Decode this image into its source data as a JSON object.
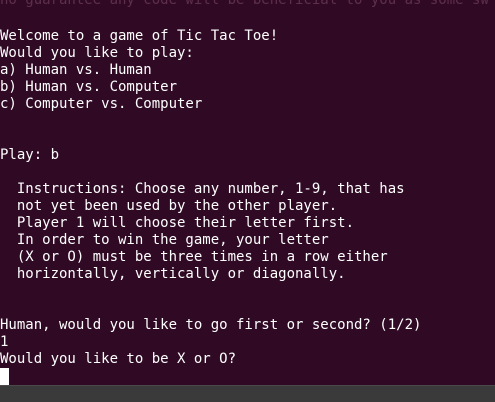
{
  "terminal": {
    "scrolled_text": "no guarantee any code will be beneficial to you as some sw",
    "lines": [
      "Welcome to a game of Tic Tac Toe!",
      "Would you like to play:",
      "a) Human vs. Human",
      "b) Human vs. Computer",
      "c) Computer vs. Computer",
      "",
      "",
      "",
      "Play: b",
      "",
      "  Instructions: Choose any number, 1-9, that has",
      "  not yet been used by the other player.",
      "  Player 1 will choose their letter first.",
      "  In order to win the game, your letter",
      "  (X or O) must be three times in a row either",
      "  horizontally, vertically or diagonally.",
      "",
      "",
      "",
      "Human, would you like to go first or second? (1/2)",
      "1",
      "Would you like to be X or O?"
    ],
    "colors": {
      "background": "#300a24",
      "text": "#ffffff",
      "cursor": "#ffffff"
    }
  }
}
